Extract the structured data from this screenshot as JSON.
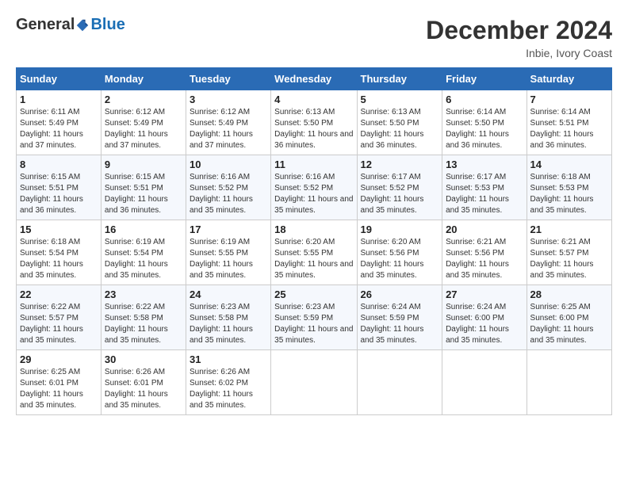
{
  "logo": {
    "text1": "General",
    "text2": "Blue"
  },
  "title": "December 2024",
  "location": "Inbie, Ivory Coast",
  "days_of_week": [
    "Sunday",
    "Monday",
    "Tuesday",
    "Wednesday",
    "Thursday",
    "Friday",
    "Saturday"
  ],
  "weeks": [
    [
      {
        "day": "1",
        "sunrise": "6:11 AM",
        "sunset": "5:49 PM",
        "daylight": "11 hours and 37 minutes."
      },
      {
        "day": "2",
        "sunrise": "6:12 AM",
        "sunset": "5:49 PM",
        "daylight": "11 hours and 37 minutes."
      },
      {
        "day": "3",
        "sunrise": "6:12 AM",
        "sunset": "5:49 PM",
        "daylight": "11 hours and 37 minutes."
      },
      {
        "day": "4",
        "sunrise": "6:13 AM",
        "sunset": "5:50 PM",
        "daylight": "11 hours and 36 minutes."
      },
      {
        "day": "5",
        "sunrise": "6:13 AM",
        "sunset": "5:50 PM",
        "daylight": "11 hours and 36 minutes."
      },
      {
        "day": "6",
        "sunrise": "6:14 AM",
        "sunset": "5:50 PM",
        "daylight": "11 hours and 36 minutes."
      },
      {
        "day": "7",
        "sunrise": "6:14 AM",
        "sunset": "5:51 PM",
        "daylight": "11 hours and 36 minutes."
      }
    ],
    [
      {
        "day": "8",
        "sunrise": "6:15 AM",
        "sunset": "5:51 PM",
        "daylight": "11 hours and 36 minutes."
      },
      {
        "day": "9",
        "sunrise": "6:15 AM",
        "sunset": "5:51 PM",
        "daylight": "11 hours and 36 minutes."
      },
      {
        "day": "10",
        "sunrise": "6:16 AM",
        "sunset": "5:52 PM",
        "daylight": "11 hours and 35 minutes."
      },
      {
        "day": "11",
        "sunrise": "6:16 AM",
        "sunset": "5:52 PM",
        "daylight": "11 hours and 35 minutes."
      },
      {
        "day": "12",
        "sunrise": "6:17 AM",
        "sunset": "5:52 PM",
        "daylight": "11 hours and 35 minutes."
      },
      {
        "day": "13",
        "sunrise": "6:17 AM",
        "sunset": "5:53 PM",
        "daylight": "11 hours and 35 minutes."
      },
      {
        "day": "14",
        "sunrise": "6:18 AM",
        "sunset": "5:53 PM",
        "daylight": "11 hours and 35 minutes."
      }
    ],
    [
      {
        "day": "15",
        "sunrise": "6:18 AM",
        "sunset": "5:54 PM",
        "daylight": "11 hours and 35 minutes."
      },
      {
        "day": "16",
        "sunrise": "6:19 AM",
        "sunset": "5:54 PM",
        "daylight": "11 hours and 35 minutes."
      },
      {
        "day": "17",
        "sunrise": "6:19 AM",
        "sunset": "5:55 PM",
        "daylight": "11 hours and 35 minutes."
      },
      {
        "day": "18",
        "sunrise": "6:20 AM",
        "sunset": "5:55 PM",
        "daylight": "11 hours and 35 minutes."
      },
      {
        "day": "19",
        "sunrise": "6:20 AM",
        "sunset": "5:56 PM",
        "daylight": "11 hours and 35 minutes."
      },
      {
        "day": "20",
        "sunrise": "6:21 AM",
        "sunset": "5:56 PM",
        "daylight": "11 hours and 35 minutes."
      },
      {
        "day": "21",
        "sunrise": "6:21 AM",
        "sunset": "5:57 PM",
        "daylight": "11 hours and 35 minutes."
      }
    ],
    [
      {
        "day": "22",
        "sunrise": "6:22 AM",
        "sunset": "5:57 PM",
        "daylight": "11 hours and 35 minutes."
      },
      {
        "day": "23",
        "sunrise": "6:22 AM",
        "sunset": "5:58 PM",
        "daylight": "11 hours and 35 minutes."
      },
      {
        "day": "24",
        "sunrise": "6:23 AM",
        "sunset": "5:58 PM",
        "daylight": "11 hours and 35 minutes."
      },
      {
        "day": "25",
        "sunrise": "6:23 AM",
        "sunset": "5:59 PM",
        "daylight": "11 hours and 35 minutes."
      },
      {
        "day": "26",
        "sunrise": "6:24 AM",
        "sunset": "5:59 PM",
        "daylight": "11 hours and 35 minutes."
      },
      {
        "day": "27",
        "sunrise": "6:24 AM",
        "sunset": "6:00 PM",
        "daylight": "11 hours and 35 minutes."
      },
      {
        "day": "28",
        "sunrise": "6:25 AM",
        "sunset": "6:00 PM",
        "daylight": "11 hours and 35 minutes."
      }
    ],
    [
      {
        "day": "29",
        "sunrise": "6:25 AM",
        "sunset": "6:01 PM",
        "daylight": "11 hours and 35 minutes."
      },
      {
        "day": "30",
        "sunrise": "6:26 AM",
        "sunset": "6:01 PM",
        "daylight": "11 hours and 35 minutes."
      },
      {
        "day": "31",
        "sunrise": "6:26 AM",
        "sunset": "6:02 PM",
        "daylight": "11 hours and 35 minutes."
      },
      null,
      null,
      null,
      null
    ]
  ]
}
